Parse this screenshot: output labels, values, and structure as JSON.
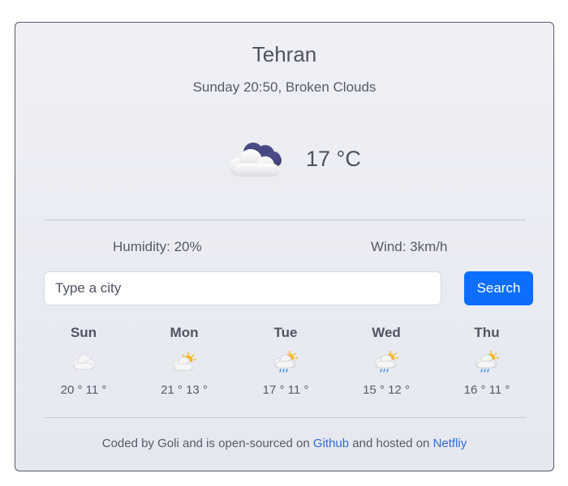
{
  "weather": {
    "city": "Tehran",
    "subtitle": "Sunday 20:50, Broken Clouds",
    "temperature": "17 °C",
    "icon": "cloud-icon",
    "humidity": "Humidity: 20%",
    "wind": "Wind: 3km/h"
  },
  "search": {
    "placeholder": "Type a city",
    "value": "",
    "button_label": "Search"
  },
  "forecast": [
    {
      "day": "Sun",
      "range": "20 ° 11 °",
      "icon": "cloudy-icon"
    },
    {
      "day": "Mon",
      "range": "21 ° 13 °",
      "icon": "partly-cloudy-icon"
    },
    {
      "day": "Tue",
      "range": "17 ° 11 °",
      "icon": "rain-sun-icon"
    },
    {
      "day": "Wed",
      "range": "15 ° 12 °",
      "icon": "rain-sun-icon"
    },
    {
      "day": "Thu",
      "range": "16 ° 11 °",
      "icon": "rain-sun-icon"
    }
  ],
  "footer": {
    "prefix": "Coded by Goli and is open-sourced on",
    "github_label": "Github",
    "middle": "and hosted on",
    "netlify_label": "Netfliy"
  },
  "colors": {
    "accent": "#0d6efd",
    "link": "#2d6bd9",
    "card_background": "#eceef4"
  }
}
